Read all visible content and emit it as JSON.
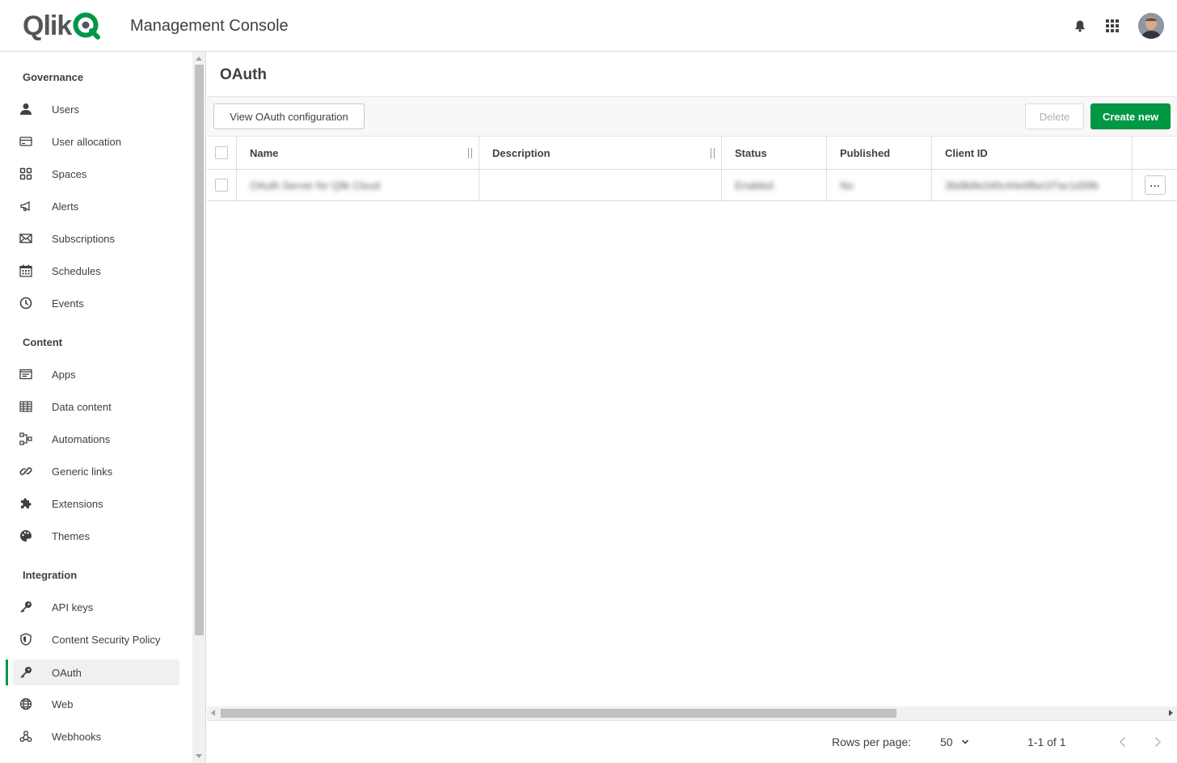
{
  "header": {
    "brand": "Qlik",
    "app_title": "Management Console",
    "icons": [
      "bell-icon",
      "app-grid-icon"
    ],
    "brand_color": "#009845"
  },
  "sidebar": {
    "sections": [
      {
        "title": "Governance",
        "items": [
          {
            "label": "Users",
            "icon": "user-icon"
          },
          {
            "label": "User allocation",
            "icon": "card-icon"
          },
          {
            "label": "Spaces",
            "icon": "spaces-icon"
          },
          {
            "label": "Alerts",
            "icon": "megaphone-icon"
          },
          {
            "label": "Subscriptions",
            "icon": "envelope-icon"
          },
          {
            "label": "Schedules",
            "icon": "calendar-icon"
          },
          {
            "label": "Events",
            "icon": "clock-icon"
          }
        ]
      },
      {
        "title": "Content",
        "items": [
          {
            "label": "Apps",
            "icon": "app-icon"
          },
          {
            "label": "Data content",
            "icon": "table-icon"
          },
          {
            "label": "Automations",
            "icon": "automation-icon"
          },
          {
            "label": "Generic links",
            "icon": "link-icon"
          },
          {
            "label": "Extensions",
            "icon": "puzzle-icon"
          },
          {
            "label": "Themes",
            "icon": "palette-icon"
          }
        ]
      },
      {
        "title": "Integration",
        "items": [
          {
            "label": "API keys",
            "icon": "key-icon"
          },
          {
            "label": "Content Security Policy",
            "icon": "shield-icon"
          },
          {
            "label": "OAuth",
            "icon": "key-icon",
            "active": true
          },
          {
            "label": "Web",
            "icon": "globe-icon"
          },
          {
            "label": "Webhooks",
            "icon": "webhook-icon"
          }
        ]
      }
    ]
  },
  "main": {
    "title": "OAuth",
    "toolbar": {
      "view_config_label": "View OAuth configuration",
      "delete_label": "Delete",
      "create_label": "Create new"
    },
    "table": {
      "columns": [
        "Name",
        "Description",
        "Status",
        "Published",
        "Client ID"
      ],
      "rows": [
        {
          "name": "OAuth Server for Qlik Cloud",
          "description": "",
          "status": "Enabled",
          "published": "No",
          "client_id": "3fa9b8e2d0c44e6fbe1f7ac1d39b"
        }
      ]
    },
    "footer": {
      "rows_per_page_label": "Rows per page:",
      "rows_per_page_value": "50",
      "page_range": "1-1 of 1"
    }
  }
}
